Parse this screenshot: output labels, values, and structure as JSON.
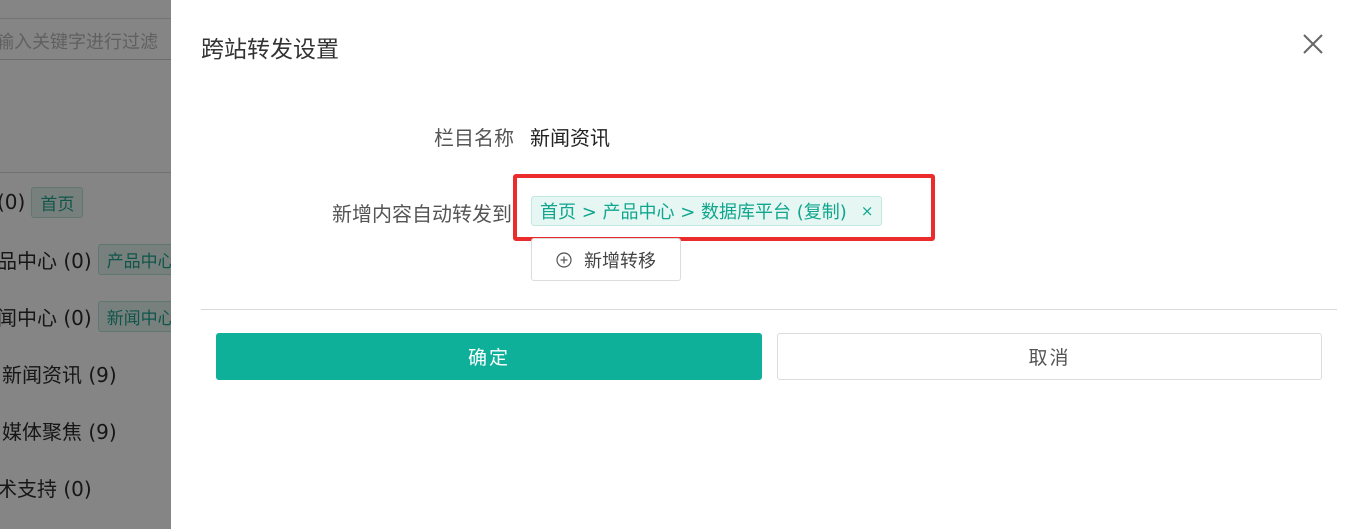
{
  "background": {
    "search_placeholder": "输入关键字进行过滤",
    "rows": [
      {
        "text": "(0)",
        "tag": "首页"
      },
      {
        "text": "品中心 (0)",
        "tag": "产品中心"
      },
      {
        "text": "闻中心 (0)",
        "tag": "新闻中心"
      },
      {
        "text": "新闻资讯 (9)",
        "tag": ""
      },
      {
        "text": "媒体聚焦 (9)",
        "tag": ""
      },
      {
        "text": "术支持 (0)",
        "tag": ""
      }
    ]
  },
  "dialog": {
    "title": "跨站转发设置",
    "close_icon": "close-icon",
    "column_name_label": "栏目名称",
    "column_name_value": "新闻资讯",
    "forward_label": "新增内容自动转发到",
    "forward_targets": [
      {
        "label": "首页 > 产品中心 > 数据库平台 (复制)",
        "remove": "×"
      }
    ],
    "add_move_label": "新增转移",
    "add_move_icon": "plus-circle-icon",
    "confirm_label": "确定",
    "cancel_label": "取消"
  },
  "colors": {
    "primary": "#0eb09a",
    "tag_text": "#10a68d",
    "highlight": "#ea2c2c"
  }
}
